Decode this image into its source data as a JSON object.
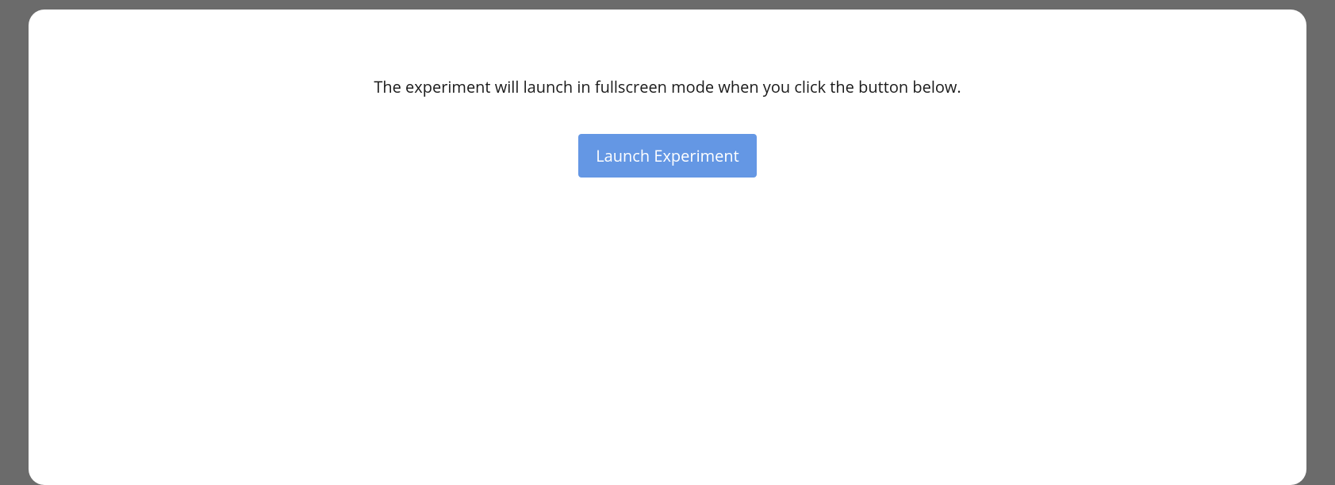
{
  "instruction": "The experiment will launch in fullscreen mode when you click the button below.",
  "button_label": "Launch Experiment"
}
